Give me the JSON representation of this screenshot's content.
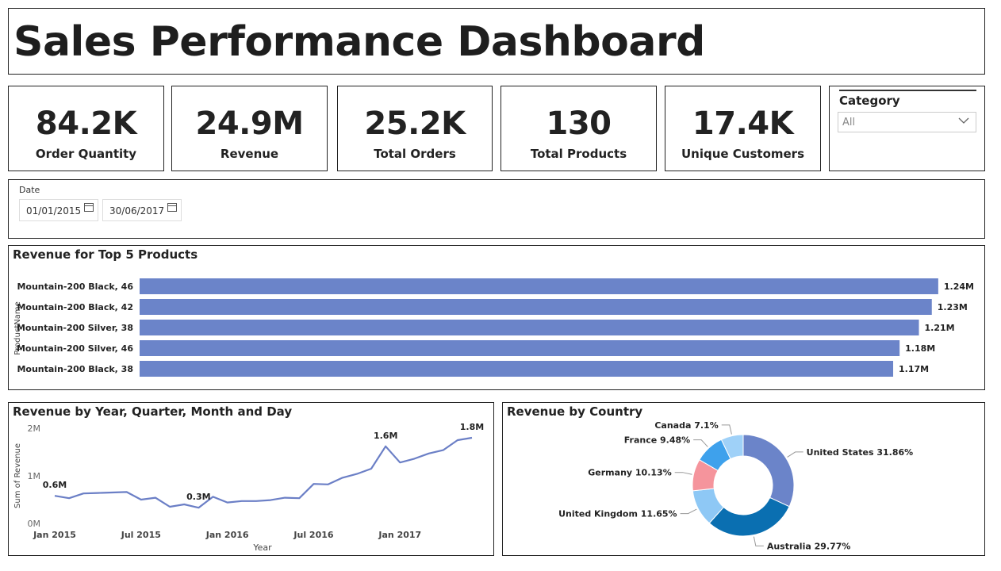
{
  "title": "Sales Performance Dashboard",
  "kpis": [
    {
      "value": "84.2K",
      "label": "Order Quantity"
    },
    {
      "value": "24.9M",
      "label": "Revenue"
    },
    {
      "value": "25.2K",
      "label": "Total Orders"
    },
    {
      "value": "130",
      "label": "Total Products"
    },
    {
      "value": "17.4K",
      "label": "Unique Customers"
    }
  ],
  "category_slicer": {
    "title": "Category",
    "selected": "All"
  },
  "date_filter": {
    "label": "Date",
    "start": "01/01/2015",
    "end": "30/06/2017"
  },
  "colors": {
    "bar": "#6b84c9",
    "line": "#6b7fc6",
    "pie": [
      "#6b84c9",
      "#0a6fb1",
      "#8ec8f5",
      "#f5949c",
      "#3ea1ec",
      "#9fd1f8"
    ]
  },
  "chart_data": [
    {
      "type": "bar",
      "title": "Revenue for Top 5 Products",
      "ylabel": "ProductName",
      "categories": [
        "Mountain-200 Black, 46",
        "Mountain-200 Black, 42",
        "Mountain-200 Silver, 38",
        "Mountain-200 Silver, 46",
        "Mountain-200 Black, 38"
      ],
      "values": [
        1.24,
        1.23,
        1.21,
        1.18,
        1.17
      ],
      "data_labels": [
        "1.24M",
        "1.23M",
        "1.21M",
        "1.18M",
        "1.17M"
      ],
      "unit": "M"
    },
    {
      "type": "line",
      "title": "Revenue by Year, Quarter, Month and Day",
      "xlabel": "Year",
      "ylabel": "Sum of Revenue",
      "yticks": [
        "0M",
        "1M",
        "2M"
      ],
      "ylim": [
        0,
        2
      ],
      "xticks": [
        {
          "label": "Jan 2015",
          "index": 0
        },
        {
          "label": "Jul 2015",
          "index": 6
        },
        {
          "label": "Jan 2016",
          "index": 12
        },
        {
          "label": "Jul 2016",
          "index": 18
        },
        {
          "label": "Jan 2017",
          "index": 24
        }
      ],
      "values": [
        0.58,
        0.53,
        0.63,
        0.64,
        0.65,
        0.66,
        0.5,
        0.54,
        0.35,
        0.4,
        0.33,
        0.56,
        0.44,
        0.47,
        0.47,
        0.49,
        0.54,
        0.53,
        0.83,
        0.82,
        0.96,
        1.04,
        1.15,
        1.62,
        1.28,
        1.36,
        1.47,
        1.54,
        1.75,
        1.8
      ],
      "data_labels": [
        {
          "index": 0,
          "text": "0.6M"
        },
        {
          "index": 10,
          "text": "0.3M"
        },
        {
          "index": 23,
          "text": "1.6M"
        },
        {
          "index": 29,
          "text": "1.8M"
        }
      ]
    },
    {
      "type": "pie",
      "title": "Revenue by Country",
      "slices": [
        {
          "label": "United States",
          "pct": 31.86,
          "text": "United States 31.86%"
        },
        {
          "label": "Australia",
          "pct": 29.77,
          "text": "Australia 29.77%"
        },
        {
          "label": "United Kingdom",
          "pct": 11.65,
          "text": "United Kingdom 11.65%"
        },
        {
          "label": "Germany",
          "pct": 10.13,
          "text": "Germany 10.13%"
        },
        {
          "label": "France",
          "pct": 9.48,
          "text": "France 9.48%"
        },
        {
          "label": "Canada",
          "pct": 7.1,
          "text": "Canada 7.1%"
        }
      ]
    }
  ]
}
